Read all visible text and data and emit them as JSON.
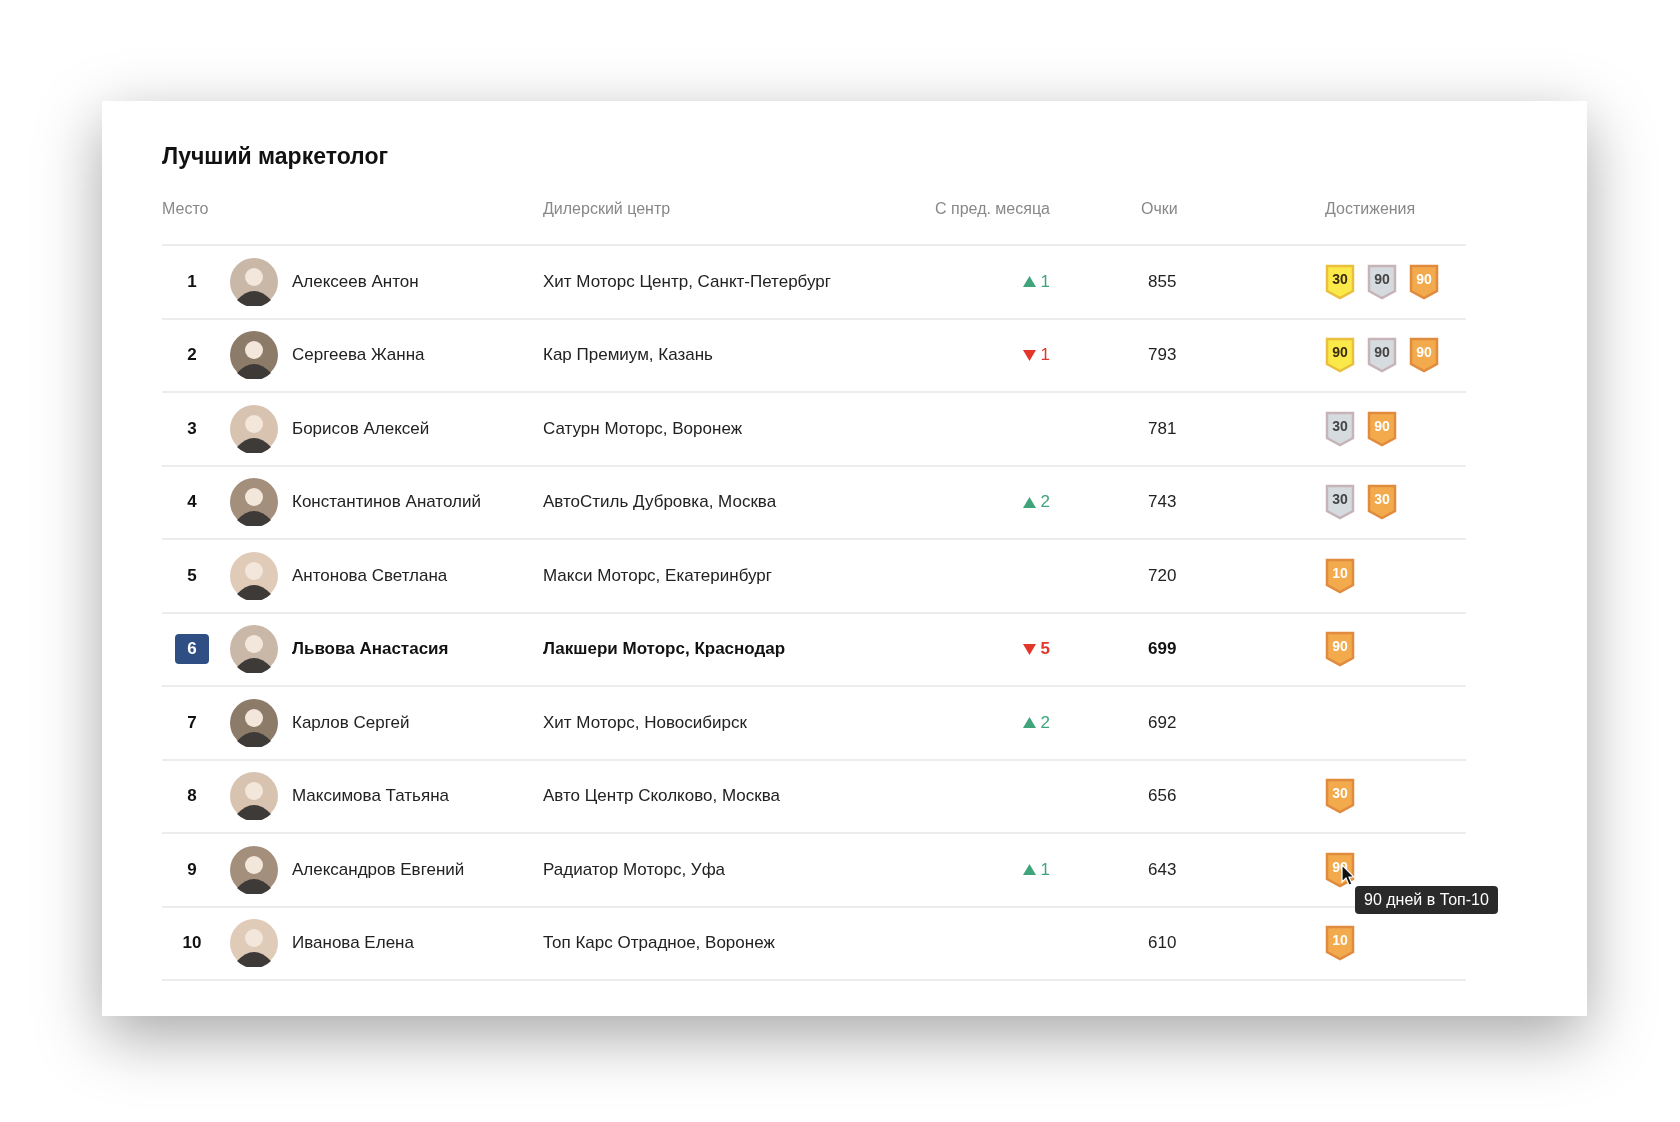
{
  "title": "Лучший маркетолог",
  "columns": [
    "Место",
    "Дилерский центр",
    "С пред. месяца",
    "Очки",
    "Достижения"
  ],
  "rows": [
    {
      "rank": "1",
      "selected": false,
      "name": "Алексеев Антон",
      "dealer": "Хит Моторс Центр, Санкт-Петербург",
      "change": {
        "kind": "up",
        "value": "1"
      },
      "points": "855",
      "badges": [
        {
          "color": "#fbe94a",
          "label": "30"
        },
        {
          "color": "#d6dbe0",
          "label": "90"
        },
        {
          "color": "#f2aa4c",
          "label": "90"
        }
      ]
    },
    {
      "rank": "2",
      "selected": false,
      "name": "Сергеева Жанна",
      "dealer": "Кар Премиум, Казань",
      "change": {
        "kind": "down",
        "value": "1"
      },
      "points": "793",
      "badges": [
        {
          "color": "#fbe94a",
          "label": "90"
        },
        {
          "color": "#d6dbe0",
          "label": "90"
        },
        {
          "color": "#f2aa4c",
          "label": "90"
        }
      ]
    },
    {
      "rank": "3",
      "selected": false,
      "name": "Борисов Алексей",
      "dealer": "Сатурн Моторс, Воронеж",
      "points": "781",
      "badges": [
        {
          "color": "#d6dbe0",
          "label": "30"
        },
        {
          "color": "#f2aa4c",
          "label": "90"
        }
      ]
    },
    {
      "rank": "4",
      "selected": false,
      "name": "Константинов Анатолий",
      "dealer": "АвтоСтиль Дубровка, Москва",
      "change": {
        "kind": "up",
        "value": "2"
      },
      "points": "743",
      "badges": [
        {
          "color": "#d6dbe0",
          "label": "30"
        },
        {
          "color": "#f2aa4c",
          "label": "30"
        }
      ]
    },
    {
      "rank": "5",
      "selected": false,
      "name": "Антонова Светлана",
      "dealer": "Макси Моторс, Екатеринбург",
      "points": "720",
      "badges": [
        {
          "color": "#f2aa4c",
          "label": "10"
        }
      ]
    },
    {
      "rank": "6",
      "selected": true,
      "name": "Львова Анастасия",
      "dealer": "Лакшери Моторс, Краснодар",
      "change": {
        "kind": "down",
        "value": "5"
      },
      "points": "699",
      "badges": [
        {
          "color": "#f2aa4c",
          "label": "90"
        }
      ]
    },
    {
      "rank": "7",
      "selected": false,
      "name": "Карлов Сергей",
      "dealer": "Хит Моторс, Новосибирск",
      "change": {
        "kind": "up",
        "value": "2"
      },
      "points": "692"
    },
    {
      "rank": "8",
      "selected": false,
      "name": "Максимова Татьяна",
      "dealer": "Авто Центр Сколково, Москва",
      "points": "656",
      "badges": [
        {
          "color": "#f2aa4c",
          "label": "30"
        }
      ]
    },
    {
      "rank": "9",
      "selected": false,
      "name": "Александров Евгений",
      "dealer": "Радиатор Моторс, Уфа",
      "change": {
        "kind": "up",
        "value": "1"
      },
      "points": "643",
      "badges": [
        {
          "color": "#f2aa4c",
          "label": "90",
          "tooltip": "90 дней в Топ-10"
        }
      ]
    },
    {
      "rank": "10",
      "selected": false,
      "name": "Иванова Елена",
      "dealer": "Топ Карс Отрадное, Воронеж",
      "points": "610",
      "badges": [
        {
          "color": "#f2aa4c",
          "label": "10"
        }
      ]
    }
  ]
}
